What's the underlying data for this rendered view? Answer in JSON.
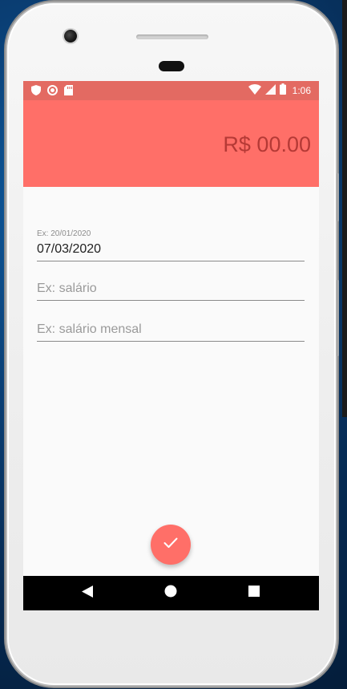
{
  "status_bar": {
    "time": "1:06",
    "icons": [
      "shield-icon",
      "circle-icon",
      "sd-card-icon",
      "wifi-icon",
      "signal-icon",
      "battery-icon"
    ]
  },
  "header": {
    "balance": "R$ 00.00"
  },
  "form": {
    "date_field": {
      "label": "Ex: 20/01/2020",
      "value": "07/03/2020"
    },
    "category_field": {
      "placeholder": "Ex: salário"
    },
    "description_field": {
      "placeholder": "Ex: salário mensal"
    }
  },
  "fab": {
    "icon": "check-icon"
  },
  "nav": {
    "icons": [
      "back-icon",
      "home-icon",
      "recents-icon"
    ]
  },
  "colors": {
    "primary": "#ff6f68",
    "primary_dark": "#e36a62",
    "balance_text": "#b53a36",
    "background": "#fafafa"
  }
}
